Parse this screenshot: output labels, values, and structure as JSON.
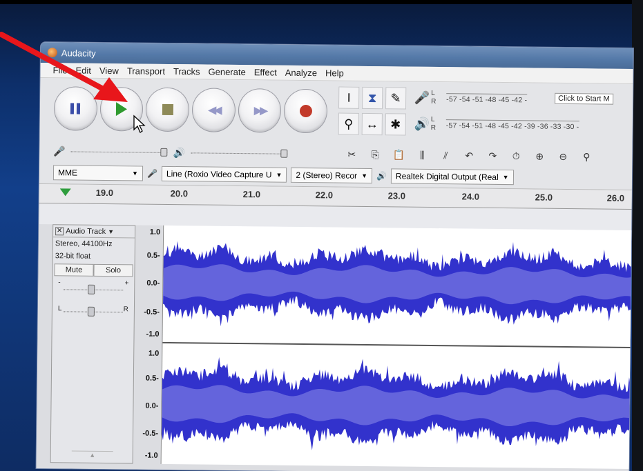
{
  "window": {
    "title": "Audacity"
  },
  "menu": [
    "File",
    "Edit",
    "View",
    "Transport",
    "Tracks",
    "Generate",
    "Effect",
    "Analyze",
    "Help"
  ],
  "transport": {
    "buttons": [
      "pause",
      "play",
      "stop",
      "skip-to-start",
      "skip-to-end",
      "record"
    ]
  },
  "meters": {
    "rec_scale": "-57 -54 -51 -48 -45 -42 -",
    "play_scale": "-57 -54 -51 -48 -45 -42 -39 -36 -33 -30 -",
    "click_to_start": "Click to Start M",
    "l": "L",
    "r": "R"
  },
  "device_bar": {
    "host": "MME",
    "input": "Line (Roxio Video Capture U",
    "channels": "2 (Stereo) Recor",
    "output": "Realtek Digital Output (Real"
  },
  "ruler": [
    "19.0",
    "20.0",
    "21.0",
    "22.0",
    "23.0",
    "24.0",
    "25.0",
    "26.0"
  ],
  "track": {
    "name": "Audio Track",
    "rate": "Stereo, 44100Hz",
    "format": "32-bit float",
    "mute": "Mute",
    "solo": "Solo",
    "gain_minus": "-",
    "gain_plus": "+",
    "pan_l": "L",
    "pan_r": "R"
  },
  "scale": {
    "ch1": [
      "1.0",
      "0.5-",
      "0.0-",
      "-0.5-",
      "-1.0"
    ],
    "ch2": [
      "1.0",
      "0.5-",
      "0.0-",
      "-0.5-",
      "-1.0"
    ]
  },
  "colors": {
    "wave": "#3232cc",
    "wave_rms": "#6464dc",
    "annotation_arrow": "#e8161b"
  }
}
